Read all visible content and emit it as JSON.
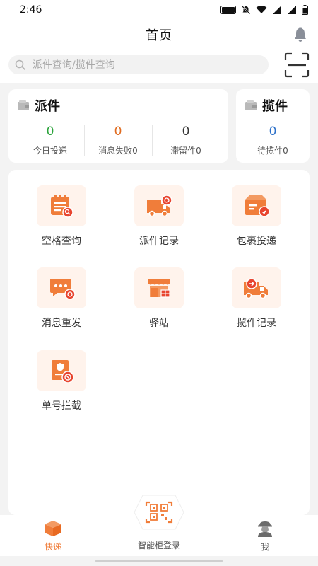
{
  "status": {
    "time": "2:46",
    "net_badge": "VoLTE2",
    "signal_badge": "4G"
  },
  "header": {
    "title": "首页"
  },
  "search": {
    "placeholder": "派件查询/揽件查询"
  },
  "pai_card": {
    "title": "派件",
    "stats": [
      {
        "value": "0",
        "label": "今日投递",
        "color": "#2aa33a"
      },
      {
        "value": "0",
        "label": "消息失败0",
        "color": "#e06b1f"
      },
      {
        "value": "0",
        "label": "滞留件0",
        "color": "#333333"
      }
    ]
  },
  "lan_card": {
    "title": "揽件",
    "stats": [
      {
        "value": "0",
        "label": "待揽件0",
        "color": "#2a6fc9"
      }
    ]
  },
  "grid": {
    "items": [
      {
        "label": "空格查询",
        "icon": "calendar-search-icon"
      },
      {
        "label": "派件记录",
        "icon": "truck-icon"
      },
      {
        "label": "包裹投递",
        "icon": "package-send-icon"
      },
      {
        "label": "消息重发",
        "icon": "message-resend-icon"
      },
      {
        "label": "驿站",
        "icon": "store-icon"
      },
      {
        "label": "揽件记录",
        "icon": "pickup-truck-icon"
      },
      {
        "label": "单号拦截",
        "icon": "block-document-icon"
      }
    ]
  },
  "tabbar": {
    "items": [
      {
        "label": "快递",
        "active": true
      },
      {
        "label": "智能柜登录",
        "active": false
      },
      {
        "label": "我",
        "active": false
      }
    ]
  },
  "colors": {
    "accent": "#f07d3a",
    "tile_bg": "#fff3ec",
    "active_tab": "#f07d3a"
  }
}
